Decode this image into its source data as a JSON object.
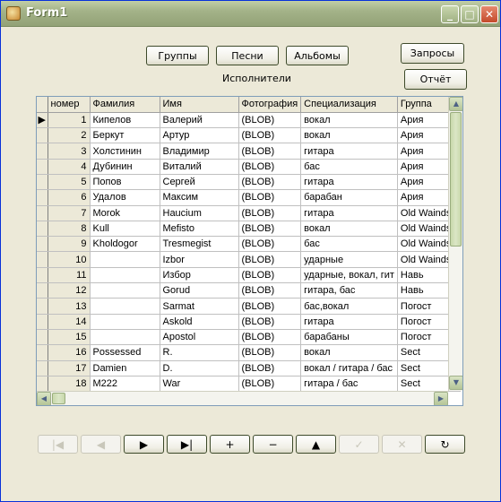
{
  "window": {
    "title": "Form1",
    "minimize": "_",
    "maximize": "□",
    "close": "✕"
  },
  "buttons": {
    "groups": "Группы",
    "songs": "Песни",
    "albums": "Альбомы",
    "queries": "Запросы",
    "report": "Отчёт"
  },
  "caption": "Исполнители",
  "grid": {
    "columns": [
      "номер",
      "Фамилия",
      "Имя",
      "Фотография",
      "Специализация",
      "Группа"
    ],
    "rows": [
      [
        "1",
        "Кипелов",
        "Валерий",
        "(BLOB)",
        "вокал",
        "Ария"
      ],
      [
        "2",
        "Беркут",
        "Артур",
        "(BLOB)",
        "вокал",
        "Ария"
      ],
      [
        "3",
        "Холстинин",
        "Владимир",
        "(BLOB)",
        "гитара",
        "Ария"
      ],
      [
        "4",
        "Дубинин",
        "Виталий",
        "(BLOB)",
        "бас",
        "Ария"
      ],
      [
        "5",
        "Попов",
        "Сергей",
        "(BLOB)",
        "гитара",
        "Ария"
      ],
      [
        "6",
        "Удалов",
        "Максим",
        "(BLOB)",
        "барабан",
        "Ария"
      ],
      [
        "7",
        "Morok",
        "Haucium",
        "(BLOB)",
        "гитара",
        "Old Wainds"
      ],
      [
        "8",
        "Kull",
        "Mefisto",
        "(BLOB)",
        "вокал",
        "Old Wainds"
      ],
      [
        "9",
        "Kholdogor",
        "Tresmegist",
        "(BLOB)",
        "бас",
        "Old Wainds"
      ],
      [
        "10",
        "",
        "Izbor",
        "(BLOB)",
        "ударные",
        "Old Wainds"
      ],
      [
        "11",
        "",
        "Избор",
        "(BLOB)",
        "ударные, вокал, гит",
        "Навь"
      ],
      [
        "12",
        "",
        "Gorud",
        "(BLOB)",
        "гитара, бас",
        "Навь"
      ],
      [
        "13",
        "",
        "Sarmat",
        "(BLOB)",
        "бас,вокал",
        "Погост"
      ],
      [
        "14",
        "",
        "Askold",
        "(BLOB)",
        "гитара",
        "Погост"
      ],
      [
        "15",
        "",
        "Apostol",
        "(BLOB)",
        "барабаны",
        "Погост"
      ],
      [
        "16",
        "Possessed",
        "R.",
        "(BLOB)",
        "вокал",
        "Sect"
      ],
      [
        "17",
        "Damien",
        "D.",
        "(BLOB)",
        "вокал / гитара / бас",
        "Sect"
      ],
      [
        "18",
        "M222",
        "War",
        "(BLOB)",
        "гитара / бас",
        "Sect"
      ]
    ],
    "current_row_indicator": "▶"
  },
  "navigator": [
    {
      "name": "first-record-button",
      "glyph": "|◀",
      "enabled": false
    },
    {
      "name": "prior-record-button",
      "glyph": "◀",
      "enabled": false
    },
    {
      "name": "next-record-button",
      "glyph": "▶",
      "enabled": true
    },
    {
      "name": "last-record-button",
      "glyph": "▶|",
      "enabled": true
    },
    {
      "name": "insert-record-button",
      "glyph": "+",
      "enabled": true
    },
    {
      "name": "delete-record-button",
      "glyph": "−",
      "enabled": true
    },
    {
      "name": "edit-record-button",
      "glyph": "▲",
      "enabled": true
    },
    {
      "name": "post-edit-button",
      "glyph": "✓",
      "enabled": false
    },
    {
      "name": "cancel-edit-button",
      "glyph": "✕",
      "enabled": false
    },
    {
      "name": "refresh-button",
      "glyph": "↻",
      "enabled": true
    }
  ]
}
